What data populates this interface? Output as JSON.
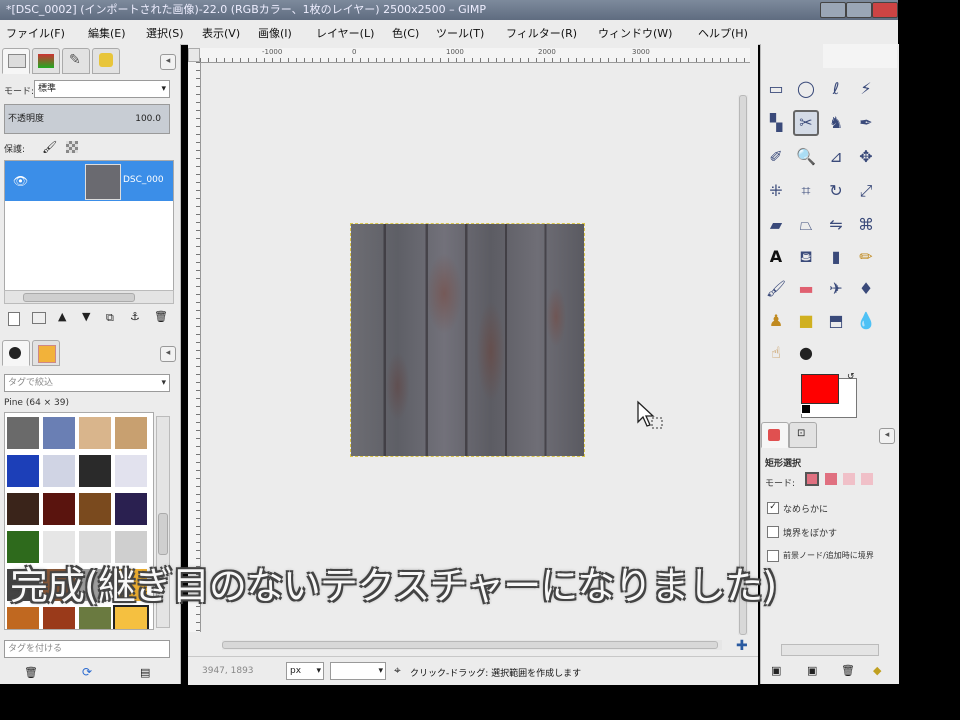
{
  "window": {
    "title": "*[DSC_0002] (インポートされた画像)-22.0 (RGBカラー、1枚のレイヤー) 2500x2500 – GIMP"
  },
  "menu": [
    "ファイル(F)",
    "編集(E)",
    "選択(S)",
    "表示(V)",
    "画像(I)",
    "レイヤー(L)",
    "色(C)",
    "ツール(T)",
    "フィルター(R)",
    "ウィンドウ(W)",
    "ヘルプ(H)"
  ],
  "layers_panel": {
    "mode_label": "モード:",
    "mode_value": "標準",
    "opacity_label": "不透明度",
    "opacity_value": "100.0",
    "lock_label": "保護:",
    "layer_name": "DSC_000"
  },
  "patterns_panel": {
    "tag_filter_placeholder": "タグで絞込",
    "selected_pattern": "Pine (64 × 39)",
    "tag_input_placeholder": "タグを付ける"
  },
  "ruler": {
    "ticks": [
      "-1000",
      "0",
      "1000",
      "2000",
      "3000"
    ]
  },
  "status": {
    "coords": "3947, 1893",
    "unit": "px",
    "zoom": "",
    "message": "クリック-ドラッグ: 選択範囲を作成します"
  },
  "toolbox": {
    "foreground_color": "#ff0000",
    "background_color": "#ffffff"
  },
  "tool_options": {
    "title": "矩形選択",
    "mode_label": "モード:",
    "antialias_label": "なめらかに",
    "antialias_checked": true,
    "feather_label": "境界をぼかす",
    "feather_checked": false,
    "expand_label": "前景ノード/追加時に境界"
  },
  "subtitle": "完成(継ぎ目のないテクスチャーになりました)"
}
